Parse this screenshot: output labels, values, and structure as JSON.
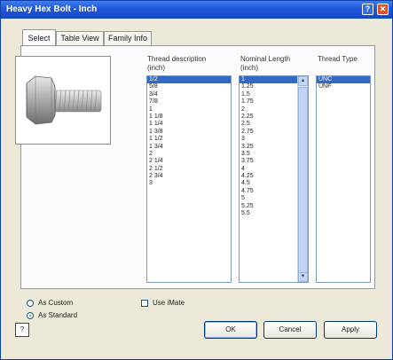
{
  "window": {
    "title": "Heavy Hex Bolt - Inch"
  },
  "tabs": [
    "Select",
    "Table View",
    "Family Info"
  ],
  "columns": {
    "thread_description": {
      "header": [
        "Thread description",
        "(inch)"
      ]
    },
    "nominal_length": {
      "header": [
        "Nominal Length",
        "(inch)"
      ]
    },
    "thread_type": {
      "header": [
        "Thread Type"
      ]
    }
  },
  "lists": {
    "thread_description": [
      "1/2",
      "5/8",
      "3/4",
      "7/8",
      "1",
      "1 1/8",
      "1 1/4",
      "1 3/8",
      "1 1/2",
      "1 3/4",
      "2",
      "2 1/4",
      "2 1/2",
      "2 3/4",
      "3"
    ],
    "nominal_length": [
      "1",
      "1.25",
      "1.5",
      "1.75",
      "2",
      "2.25",
      "2.5",
      "2.75",
      "3",
      "3.25",
      "3.5",
      "3.75",
      "4",
      "4.25",
      "4.5",
      "4.75",
      "5",
      "5.25",
      "5.5"
    ],
    "thread_type": [
      "UNC",
      "UNF"
    ]
  },
  "options": {
    "as_custom": "As Custom",
    "as_standard": "As Standard",
    "use_iparts": "Use iMate"
  },
  "buttons": {
    "ok": "OK",
    "cancel": "Cancel",
    "apply": "Apply"
  }
}
